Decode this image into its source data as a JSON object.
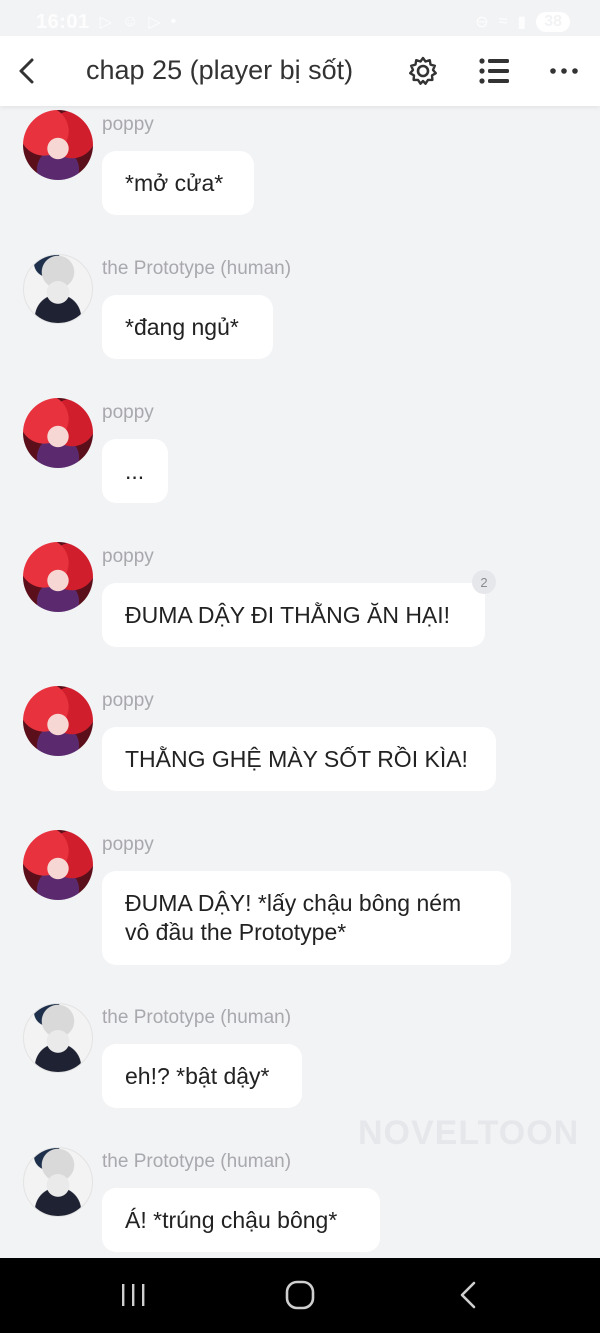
{
  "status_bar": {
    "time": "16:01",
    "battery": "38",
    "left_icons": [
      "play-store-icon",
      "game-icon",
      "play-icon",
      "dot-icon"
    ],
    "right_icons": [
      "do-not-disturb-icon",
      "wifi-icon",
      "signal-icon"
    ]
  },
  "header": {
    "title": "chap 25 (player bị sốt)",
    "icons": [
      "back-arrow-icon",
      "gear-icon",
      "list-icon",
      "more-icon"
    ]
  },
  "messages": [
    {
      "sender": "poppy",
      "avatar": "poppy",
      "text": "*mở cửa*"
    },
    {
      "sender": "the Prototype (human)",
      "avatar": "prototype",
      "text": "*đang ngủ*"
    },
    {
      "sender": "poppy",
      "avatar": "poppy",
      "text": "..."
    },
    {
      "sender": "poppy",
      "avatar": "poppy",
      "text": "ĐUMA DẬY ĐI THẰNG ĂN HẠI!",
      "comment_count": "2"
    },
    {
      "sender": "poppy",
      "avatar": "poppy",
      "text": "THẰNG GHỆ MÀY SỐT RỒI KÌA!"
    },
    {
      "sender": "poppy",
      "avatar": "poppy",
      "text": "ĐUMA DẬY! *lấy chậu bông ném\nvô đầu the Prototype*"
    },
    {
      "sender": "the Prototype (human)",
      "avatar": "prototype",
      "text": "eh!? *bật dậy*"
    },
    {
      "sender": "the Prototype (human)",
      "avatar": "prototype",
      "text": "Á! *trúng chậu bông*"
    }
  ],
  "watermark": "NOVELTOON",
  "nav_bar": {
    "icons": [
      "recent-apps-icon",
      "home-icon",
      "back-icon"
    ]
  },
  "colors": {
    "background": "#f2f3f5",
    "bubble": "#ffffff",
    "sender_text": "#a8a8ad",
    "nav_bar": "#000000"
  }
}
